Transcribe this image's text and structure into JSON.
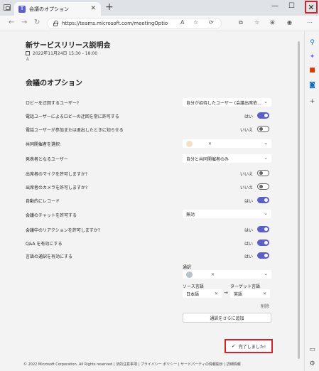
{
  "browser": {
    "tab_title": "会議のオプション",
    "url": "https://teams.microsoft.com/meetingOptions?t...",
    "tab_close": "✕",
    "new_tab": "+",
    "minimize": "—",
    "maximize": "☐",
    "close": "✕"
  },
  "meeting": {
    "title": "新サービスリリース説明会",
    "datetime": "2022年11月24日 15:30 - 18:00"
  },
  "options": {
    "section_title": "会議のオプション",
    "rows": [
      {
        "label": "ロビーを迂回するユーザー?",
        "dropdown": "自分が招待したユーザー (会議出席依..."
      },
      {
        "label": "電話ユーザーによるロビーの迂回を常に許可する",
        "value": "はい",
        "on": true
      },
      {
        "label": "電話ユーザーが参加または退出したときに知らせる",
        "value": "いいえ",
        "on": false
      },
      {
        "label": "共同開催者を選択:"
      },
      {
        "label": "発表者となるユーザー",
        "dropdown": "自分と共同開催者のみ"
      },
      {
        "label": "出席者のマイクを許可しますか?",
        "value": "いいえ",
        "on": false
      },
      {
        "label": "出席者のカメラを許可しますか?",
        "value": "いいえ",
        "on": false
      },
      {
        "label": "自動的にレコード",
        "value": "はい",
        "on": true
      },
      {
        "label": "会議のチャットを許可する",
        "dropdown": "無効"
      },
      {
        "label": "会議中のリアクションを許可しますか?",
        "value": "はい",
        "on": true
      },
      {
        "label": "Q&A を有効にする",
        "value": "はい",
        "on": true
      },
      {
        "label": "言語の通訳を有効にする",
        "value": "はい",
        "on": true
      }
    ],
    "interpreter": {
      "label": "通訳",
      "source_label": "ソース言語",
      "target_label": "ターゲット言語",
      "source_value": "日本語",
      "target_value": "英語",
      "delete": "削除",
      "add_button": "通訳をさらに追加"
    },
    "done_button": "完了しました!"
  },
  "footer": "© 2022 Microsoft Corporation. All Rights reserved  |  法的注意事項  |  プライバシー ポリシー  |  サードパーティの情報開示  |  詳細情報",
  "colors": {
    "accent": "#5b5fc7",
    "highlight": "#d6202a"
  }
}
